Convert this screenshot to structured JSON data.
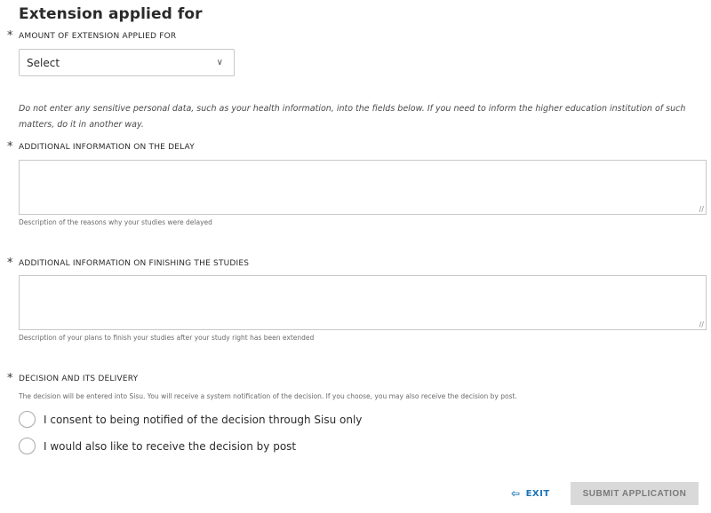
{
  "section": {
    "title": "Extension applied for"
  },
  "required_marker": "*",
  "extension_amount": {
    "label": "AMOUNT OF EXTENSION APPLIED FOR",
    "selected": "Select",
    "chevron_icon": "chevron-down-icon"
  },
  "notice": "Do not enter any sensitive personal data, such as your health information, into the fields below. If you need to inform the higher education institution of such matters, do it in another way.",
  "delay_info": {
    "label": "ADDITIONAL INFORMATION ON THE DELAY",
    "value": "",
    "help": "Description of the reasons why your studies were delayed"
  },
  "finishing_info": {
    "label": "ADDITIONAL INFORMATION ON FINISHING THE STUDIES",
    "value": "",
    "help": "Description of your plans to finish your studies after your study right has been extended"
  },
  "decision": {
    "label": "DECISION AND ITS DELIVERY",
    "description": "The decision will be entered into Sisu. You will receive a system notification of the decision. If you choose, you may also receive the decision by post.",
    "options": [
      {
        "label": "I consent to being notified of the decision through Sisu only",
        "selected": false
      },
      {
        "label": "I would also like to receive the decision by post",
        "selected": false
      }
    ]
  },
  "actions": {
    "exit_label": "EXIT",
    "exit_icon": "exit-arrow-icon",
    "submit_label": "SUBMIT APPLICATION",
    "submit_enabled": false
  },
  "colors": {
    "link": "#1a73b8",
    "disabled_button_bg": "#d9d9d9",
    "disabled_button_text": "#7a7a7a"
  }
}
